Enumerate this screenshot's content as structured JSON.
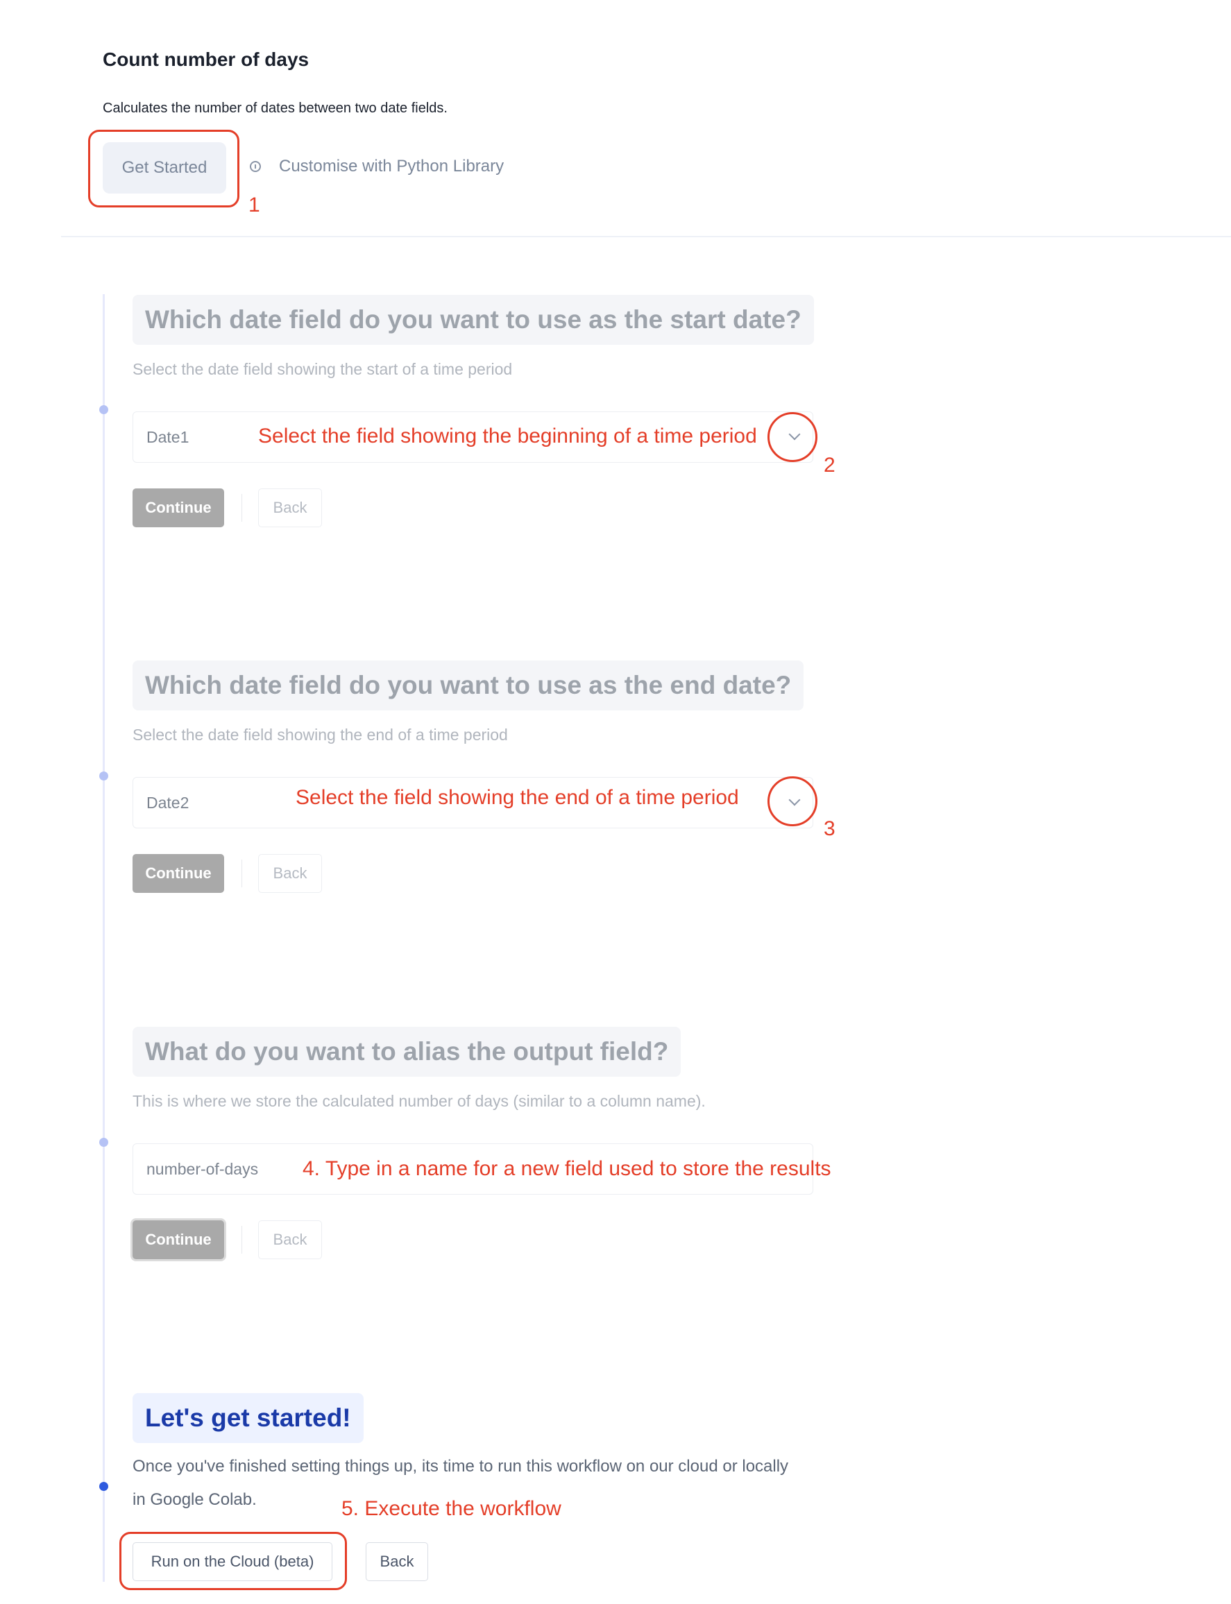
{
  "header": {
    "title": "Count number of days",
    "description": "Calculates the number of dates between two date fields.",
    "get_started_label": "Get Started",
    "customise_label": "Customise with Python Library",
    "info_icon": "info-circle-icon"
  },
  "steps": [
    {
      "question": "Which date field do you want to use as the start date?",
      "hint": "Select the date field showing the start of a time period",
      "field_value": "Date1",
      "continue_label": "Continue",
      "back_label": "Back"
    },
    {
      "question": "Which date field do you want to use as the end date?",
      "hint": "Select the date field showing the end of a time period",
      "field_value": "Date2",
      "continue_label": "Continue",
      "back_label": "Back"
    },
    {
      "question": "What do you want to alias the output field?",
      "hint": "This is where we store the calculated number of days (similar to a column name).",
      "field_value": "number-of-days",
      "continue_label": "Continue",
      "back_label": "Back"
    }
  ],
  "final": {
    "heading": "Let's get started!",
    "body_line1": "Once you've finished setting things up, its time to run this workflow on our cloud or locally",
    "body_line2": "in Google Colab.",
    "run_label": "Run on the Cloud (beta)",
    "back_label": "Back"
  },
  "annotations": {
    "n1": "1",
    "n2": "2",
    "n3": "3",
    "a2_text": "Select the field showing the beginning of a time period",
    "a3_text": "Select the field showing the end of a time period",
    "a4_text": "4. Type in a name for a new field used to store the results",
    "a5_text": "5. Execute the workflow"
  },
  "colors": {
    "annotation": "#e43e28",
    "accent_blue": "#1a3aa8",
    "continue_bg": "#a9a9a9"
  }
}
